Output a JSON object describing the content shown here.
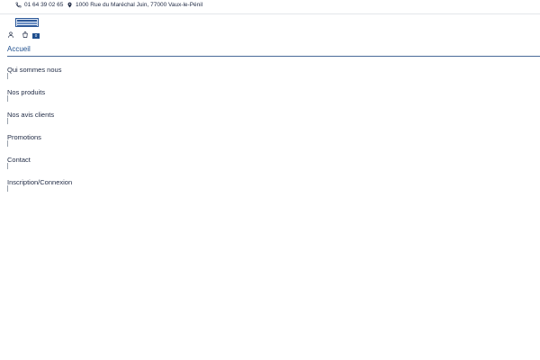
{
  "topbar": {
    "phone": "01 64 39 02 65",
    "address": "1000 Rue du Maréchal Juin, 77000 Vaux-le-Pénil",
    "phone_icon": "phone-icon",
    "location_icon": "location-pin-icon"
  },
  "header": {
    "user_icon": "user-icon",
    "cart_icon": "cart-icon",
    "cart_count": "0"
  },
  "nav": {
    "home": "Accueil",
    "items": [
      "Qui sommes nous",
      "Nos produits",
      "Nos avis clients",
      "Promotions",
      "Contact",
      "Inscription/Connexion"
    ]
  },
  "colors": {
    "accent": "#1f4f8e",
    "text": "#1f2a44",
    "divider": "#e3e6ea"
  }
}
